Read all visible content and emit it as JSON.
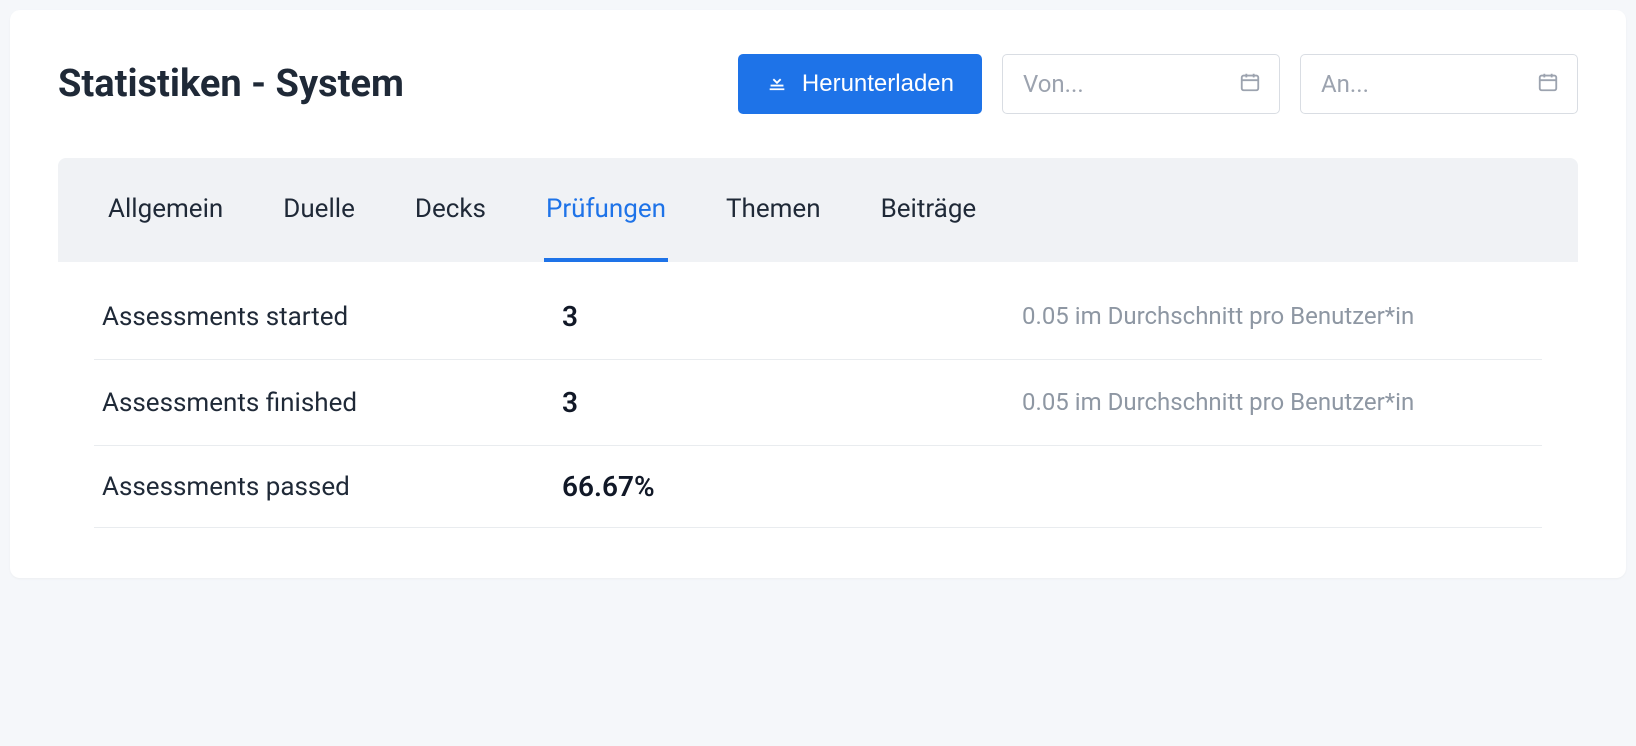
{
  "page": {
    "title": "Statistiken - System"
  },
  "toolbar": {
    "download_label": "Herunterladen",
    "date_from_placeholder": "Von...",
    "date_to_placeholder": "An..."
  },
  "tabs": [
    {
      "label": "Allgemein",
      "active": false
    },
    {
      "label": "Duelle",
      "active": false
    },
    {
      "label": "Decks",
      "active": false
    },
    {
      "label": "Prüfungen",
      "active": true
    },
    {
      "label": "Themen",
      "active": false
    },
    {
      "label": "Beiträge",
      "active": false
    }
  ],
  "stats": {
    "rows": [
      {
        "label": "Assessments started",
        "value": "3",
        "note": "0.05 im Durchschnitt pro Benutzer*in"
      },
      {
        "label": "Assessments finished",
        "value": "3",
        "note": "0.05 im Durchschnitt pro Benutzer*in"
      },
      {
        "label": "Assessments passed",
        "value": "66.67%",
        "note": ""
      }
    ]
  }
}
